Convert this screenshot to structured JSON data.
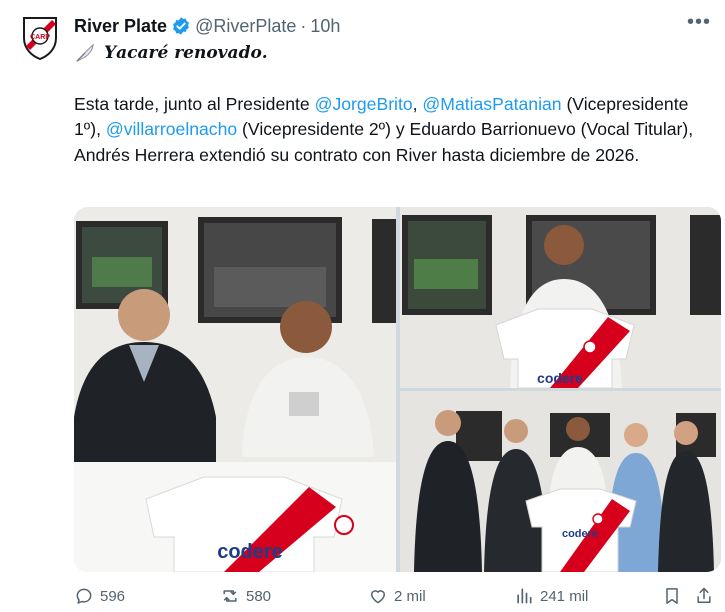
{
  "author": {
    "name": "River Plate",
    "handle": "@RiverPlate",
    "separator": "·",
    "time": "10h",
    "avatar_icon": "river-plate-crest",
    "verified_icon": "verified-badge"
  },
  "tweet": {
    "headline_icon": "quill-icon",
    "headline": "𝒀𝒂𝒄𝒂𝒓𝒆́ 𝒓𝒆𝒏𝒐𝒗𝒂𝒅𝒐.",
    "text_1": "Esta tarde, junto al Presidente ",
    "mention_1": "@JorgeBrito",
    "text_2": ", ",
    "mention_2": "@MatiasPatanian",
    "text_3": " (Vicepresidente 1º), ",
    "mention_3": "@villarroelnacho",
    "text_4": " (Vicepresidente 2º) y Eduardo Barrionuevo (Vocal Titular), Andrés Herrera extendió su contrato con River hasta diciembre de 2026."
  },
  "media": {
    "sponsor": "codere"
  },
  "actions": {
    "replies": "596",
    "retweets": "580",
    "likes": "2 mil",
    "views": "241 mil"
  },
  "colors": {
    "accent": "#1d9bf0",
    "muted": "#536471",
    "river_red": "#d6001c"
  }
}
